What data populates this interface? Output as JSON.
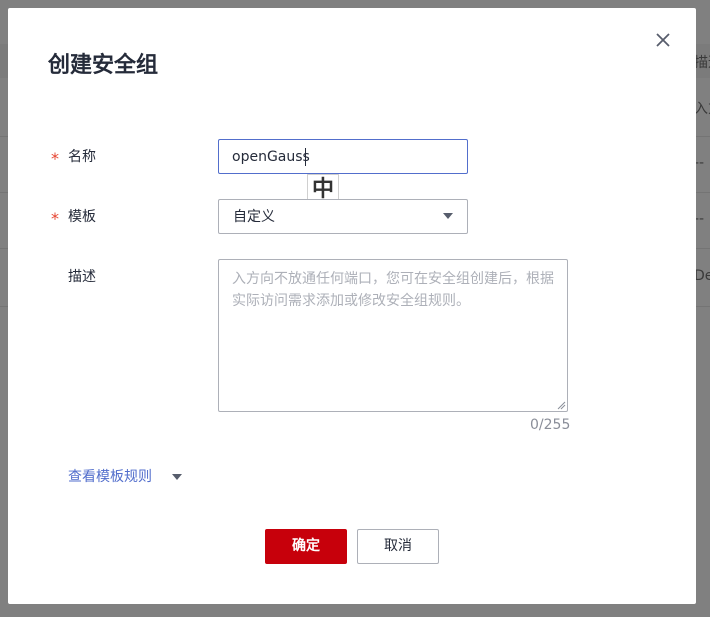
{
  "background": {
    "column_header_fragment": "描述",
    "row_fragments": [
      "入方",
      "--",
      "--",
      "De"
    ]
  },
  "dialog": {
    "title": "创建安全组",
    "close_icon": "close-icon",
    "required_mark": "*",
    "name": {
      "label": "名称",
      "value": "openGauss"
    },
    "ime_indicator": "中",
    "template": {
      "label": "模板",
      "selected": "自定义"
    },
    "description": {
      "label": "描述",
      "placeholder": "入方向不放通任何端口，您可在安全组创建后，根据实际访问需求添加或修改安全组规则。",
      "value": "",
      "counter": "0/255"
    },
    "view_template_rules": "查看模板规则",
    "buttons": {
      "ok": "确定",
      "cancel": "取消"
    }
  },
  "colors": {
    "primary_button": "#c7000b",
    "link": "#526ecc",
    "required": "#e5432f",
    "input_focus_border": "#526ecc"
  }
}
